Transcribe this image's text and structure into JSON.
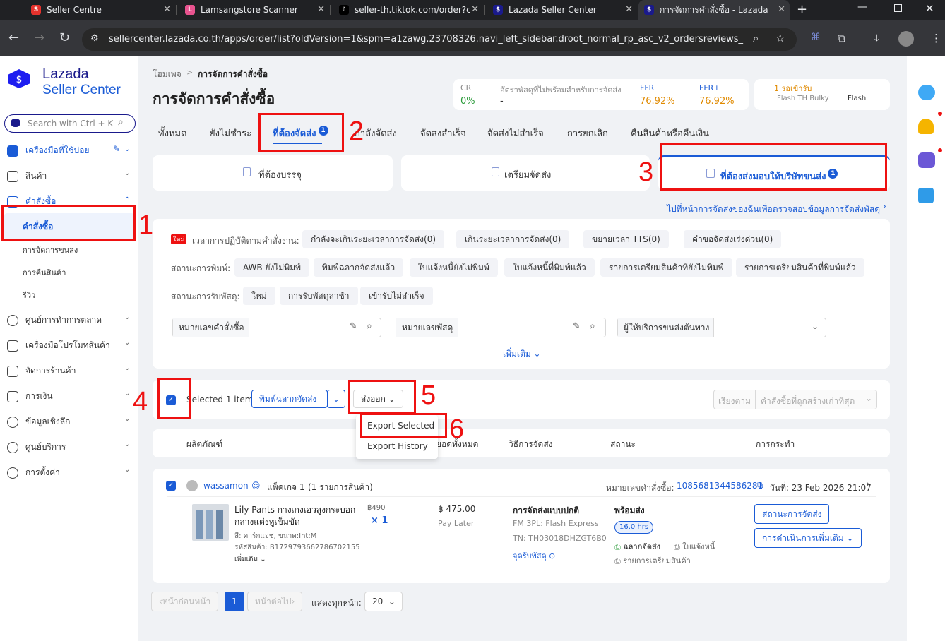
{
  "browser": {
    "tabs": [
      {
        "title": "Seller Centre",
        "color": "#e5322d",
        "glyph": "S"
      },
      {
        "title": "Lamsangstore Scanner",
        "color": "#e8538f",
        "glyph": "L"
      },
      {
        "title": "seller-th.tiktok.com/order?c",
        "color": "#000000",
        "glyph": "♪"
      },
      {
        "title": "Lazada Seller Center",
        "color": "#1a1a8c",
        "glyph": "$"
      },
      {
        "title": "การจัดการคำสั่งซื้อ - Lazada Se",
        "color": "#1a1a8c",
        "glyph": "$"
      }
    ],
    "url": "sellercenter.lazada.co.th/apps/order/list?oldVersion=1&spm=a1zawg.23708326.navi_left_sidebar.droot_normal_rp_asc_v2_ordersreviews_rp_asc_..."
  },
  "brand": {
    "name": "Lazada",
    "sub": "Seller Center"
  },
  "search": {
    "placeholder": "Search with Ctrl + K"
  },
  "sidebar": {
    "items": [
      {
        "label": "เครื่องมือที่ใช้บ่อย"
      },
      {
        "label": "สินค้า"
      },
      {
        "label": "คำสั่งซื้อ"
      },
      {
        "label": "คำสั่งซื้อ"
      },
      {
        "label": "การจัดการขนส่ง"
      },
      {
        "label": "การคืนสินค้า"
      },
      {
        "label": "รีวิว"
      },
      {
        "label": "ศูนย์การทำการตลาด"
      },
      {
        "label": "เครื่องมือโปรโมทสินค้า"
      },
      {
        "label": "จัดการร้านค้า"
      },
      {
        "label": "การเงิน"
      },
      {
        "label": "ข้อมูลเชิงลึก"
      },
      {
        "label": "ศูนย์บริการ"
      },
      {
        "label": "การตั้งค่า"
      }
    ]
  },
  "header": {
    "breadcrumb_home": "โฮมเพจ",
    "breadcrumb_sep": ">",
    "breadcrumb_current": "การจัดการคำสั่งซื้อ",
    "title": "การจัดการคำสั่งซื้อ"
  },
  "metrics": {
    "cr_label": "CR",
    "cr_value": "0%",
    "rate_label": "อัตราพัสดุที่ไม่พร้อมสำหรับการจัดส่ง",
    "rate_value": "-",
    "ffr_label": "FFR",
    "ffr_value": "76.92%",
    "ffrp_label": "FFR+",
    "ffrp_value": "76.92%",
    "pending": "1 รอเข้ารับ",
    "carrier1": "Flash TH Bulky",
    "carrier2": "Flash"
  },
  "tabs": [
    "ทั้งหมด",
    "ยังไม่ชำระ",
    "ที่ต้องจัดส่ง",
    "กำลังจัดส่ง",
    "จัดส่งสำเร็จ",
    "จัดส่งไม่สำเร็จ",
    "การยกเลิก",
    "คืนสินค้าหรือคืนเงิน"
  ],
  "tab_badge": "1",
  "subtabs": [
    "ที่ต้องบรรจุ",
    "เตรียมจัดส่ง",
    "ที่ต้องส่งมอบให้บริษัทขนส่ง"
  ],
  "subtab_badge": "1",
  "link_check": "ไปที่หน้าการจัดส่งของฉันเพื่อตรวจสอบข้อมูลการจัดส่งพัสดุ",
  "filters": {
    "new_tag": "ใหม่",
    "row1_label": "เวลาการปฏิบัติตามคำสั่งงาน:",
    "row1": [
      "กำลังจะเกินระยะเวลาการจัดส่ง(0)",
      "เกินระยะเวลาการจัดส่ง(0)",
      "ขยายเวลา TTS(0)",
      "คำขอจัดส่งเร่งด่วน(0)"
    ],
    "row2_label": "สถานะการพิมพ์:",
    "row2": [
      "AWB ยังไม่พิมพ์",
      "พิมพ์ฉลากจัดส่งแล้ว",
      "ใบแจ้งหนี้ยังไม่พิมพ์",
      "ใบแจ้งหนี้ที่พิมพ์แล้ว",
      "รายการเตรียมสินค้าที่ยังไม่พิมพ์",
      "รายการเตรียมสินค้าที่พิมพ์แล้ว"
    ],
    "row3_label": "สถานะการรับพัสดุ:",
    "row3": [
      "ใหม่",
      "การรับพัสดุล่าช้า",
      "เข้ารับไม่สำเร็จ"
    ],
    "order_no": "หมายเลขคำสั่งซื้อ",
    "parcel_no": "หมายเลขพัสดุ",
    "carrier": "ผู้ให้บริการขนส่งต้นทาง",
    "more": "เพิ่มเติม"
  },
  "toolbar": {
    "selected": "Selected 1 item",
    "print_label": "พิมพ์ฉลากจัดส่ง",
    "export": "ส่งออก",
    "export_selected": "Export Selected",
    "export_history": "Export History",
    "sort_label": "เรียงตาม",
    "sort_value": "คำสั่งซื้อที่ถูกสร้างเก่าที่สุด"
  },
  "table_headers": [
    "ผลิตภัณฑ์",
    "ยอดทั้งหมด",
    "วิธีการจัดส่ง",
    "สถานะ",
    "การกระทำ"
  ],
  "order": {
    "buyer": "wassamon",
    "package": "แพ็คเกจ 1",
    "items": "(1 รายการสินค้า)",
    "order_label": "หมายเลขคำสั่งซื้อ:",
    "order_no": "1085681344586281",
    "date": "วันที่: 23 Feb 2026 21:07",
    "product_name": "Lily Pants กางเกงเอวสูงกระบอก กลางแต่งหูเข็มขัด",
    "variant": "สี: คาร์กแอช, ขนาด:Int:M",
    "sku": "รหัสสินค้า: B1729793662786702155",
    "more": "เพิ่มเติม",
    "unit_price": "฿490",
    "qty": "× 1",
    "total": "฿ 475.00",
    "payment": "Pay Later",
    "ship_method": "การจัดส่งแบบปกติ",
    "carrier": "FM 3PL: Flash Express",
    "tracking": "TN: TH03018DHZGT6B0",
    "dropoff": "จุดรับพัสดุ",
    "status": "พร้อมส่ง",
    "hrs": "16.0 hrs",
    "doc1": "ฉลากจัดส่ง",
    "doc2": "ใบแจ้งหนี้",
    "doc3": "รายการเตรียมสินค้า",
    "action1": "สถานะการจัดส่ง",
    "action2": "การดำเนินการเพิ่มเติม"
  },
  "pagination": {
    "prev": "หน้าก่อนหน้า",
    "page": "1",
    "next": "หน้าต่อไป",
    "per_page_label": "แสดงทุกหน้า:",
    "per_page": "20"
  },
  "annotations": [
    "1",
    "2",
    "3",
    "4",
    "5",
    "6"
  ]
}
